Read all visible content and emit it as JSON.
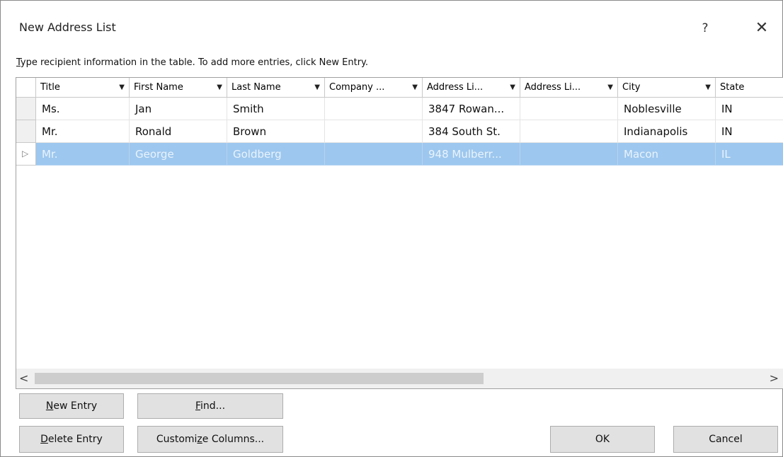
{
  "dialog": {
    "title": "New Address List",
    "help_label": "?",
    "close_label": "✕",
    "instruction": "Type recipient information in the table.  To add more entries, click New Entry."
  },
  "columns": [
    {
      "label": "Title"
    },
    {
      "label": "First Name"
    },
    {
      "label": "Last Name"
    },
    {
      "label": "Company ..."
    },
    {
      "label": "Address Li..."
    },
    {
      "label": "Address Li..."
    },
    {
      "label": "City"
    },
    {
      "label": "State"
    }
  ],
  "rows": [
    {
      "cells": [
        "Ms.",
        "Jan",
        "Smith",
        "",
        "3847 Rowan...",
        "",
        "Noblesville",
        "IN"
      ]
    },
    {
      "cells": [
        "Mr.",
        "Ronald",
        "Brown",
        "",
        "384 South St.",
        "",
        "Indianapolis",
        "IN"
      ]
    },
    {
      "cells": [
        "Mr.",
        "George",
        "Goldberg",
        "",
        "948 Mulberr...",
        "",
        "Macon",
        "IL"
      ]
    }
  ],
  "row_marker": "▷",
  "scroll": {
    "left": "<",
    "right": ">"
  },
  "buttons": {
    "new_entry": {
      "mnemonic": "N",
      "rest": "ew Entry"
    },
    "find": {
      "mnemonic": "F",
      "rest": "ind..."
    },
    "delete_entry": {
      "mnemonic": "D",
      "rest": "elete Entry"
    },
    "customize_columns": {
      "pre": "Customi",
      "mnemonic": "z",
      "rest": "e Columns..."
    },
    "ok": "OK",
    "cancel": "Cancel"
  },
  "colors": {
    "selected_row": "#9dc7ee",
    "button_face": "#e1e1e1"
  }
}
